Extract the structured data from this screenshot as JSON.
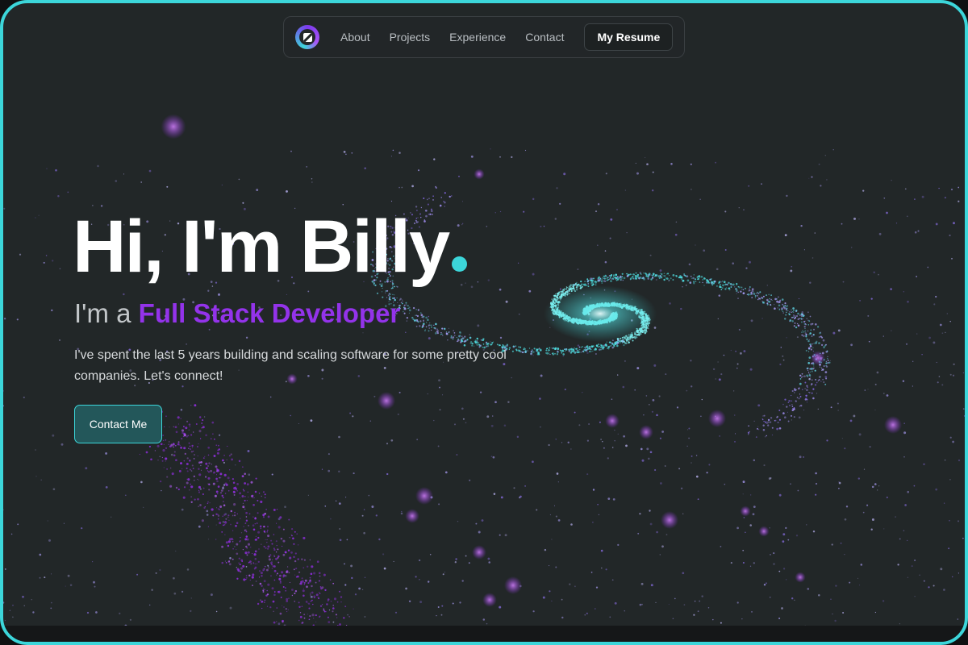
{
  "nav": {
    "logo": "Z",
    "links": [
      "About",
      "Projects",
      "Experience",
      "Contact"
    ],
    "resume_label": "My Resume"
  },
  "hero": {
    "title": "Hi, I'm Billy",
    "subtitle_prefix": "I'm a ",
    "role": "Full Stack Developer",
    "description": "I've spent the last 5 years building and scaling software for some pretty cool companies. Let's connect!",
    "contact_label": "Contact Me"
  },
  "colors": {
    "accent_cyan": "#3cd6da",
    "accent_purple": "#9333ea",
    "background": "#222728"
  },
  "icons": {
    "logo": "logo-icon",
    "hero_dot": "dot-icon"
  }
}
